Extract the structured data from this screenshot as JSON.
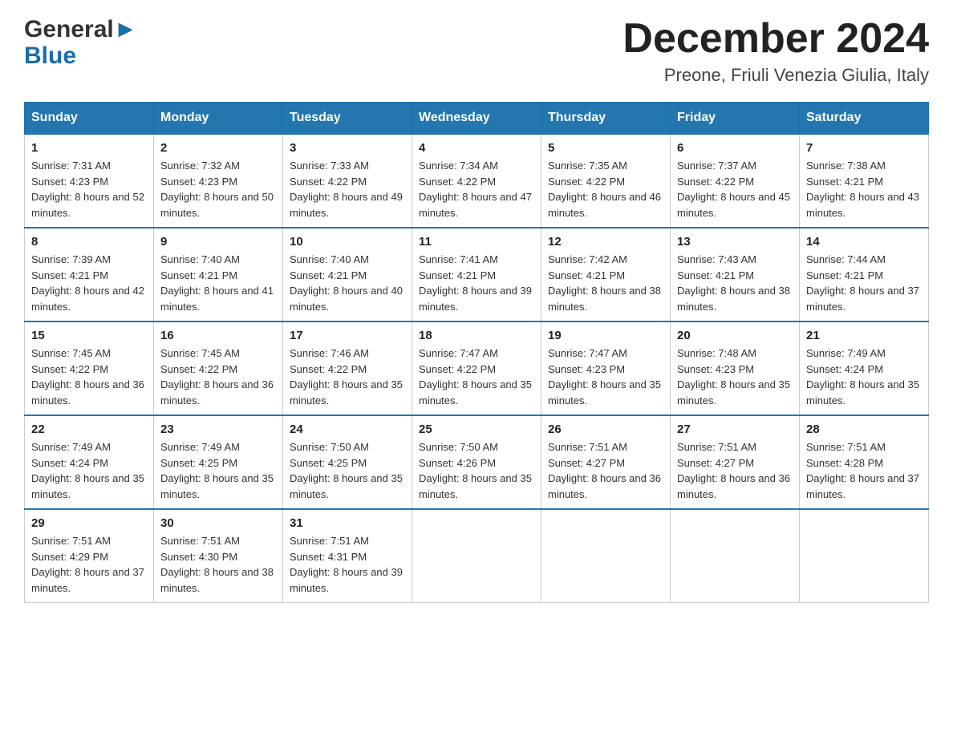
{
  "header": {
    "logo_line1_black": "General",
    "logo_line1_blue": "▶",
    "logo_line2": "Blue",
    "main_title": "December 2024",
    "subtitle": "Preone, Friuli Venezia Giulia, Italy"
  },
  "calendar": {
    "days_of_week": [
      "Sunday",
      "Monday",
      "Tuesday",
      "Wednesday",
      "Thursday",
      "Friday",
      "Saturday"
    ],
    "weeks": [
      [
        {
          "day": "1",
          "sunrise": "7:31 AM",
          "sunset": "4:23 PM",
          "daylight": "8 hours and 52 minutes."
        },
        {
          "day": "2",
          "sunrise": "7:32 AM",
          "sunset": "4:23 PM",
          "daylight": "8 hours and 50 minutes."
        },
        {
          "day": "3",
          "sunrise": "7:33 AM",
          "sunset": "4:22 PM",
          "daylight": "8 hours and 49 minutes."
        },
        {
          "day": "4",
          "sunrise": "7:34 AM",
          "sunset": "4:22 PM",
          "daylight": "8 hours and 47 minutes."
        },
        {
          "day": "5",
          "sunrise": "7:35 AM",
          "sunset": "4:22 PM",
          "daylight": "8 hours and 46 minutes."
        },
        {
          "day": "6",
          "sunrise": "7:37 AM",
          "sunset": "4:22 PM",
          "daylight": "8 hours and 45 minutes."
        },
        {
          "day": "7",
          "sunrise": "7:38 AM",
          "sunset": "4:21 PM",
          "daylight": "8 hours and 43 minutes."
        }
      ],
      [
        {
          "day": "8",
          "sunrise": "7:39 AM",
          "sunset": "4:21 PM",
          "daylight": "8 hours and 42 minutes."
        },
        {
          "day": "9",
          "sunrise": "7:40 AM",
          "sunset": "4:21 PM",
          "daylight": "8 hours and 41 minutes."
        },
        {
          "day": "10",
          "sunrise": "7:40 AM",
          "sunset": "4:21 PM",
          "daylight": "8 hours and 40 minutes."
        },
        {
          "day": "11",
          "sunrise": "7:41 AM",
          "sunset": "4:21 PM",
          "daylight": "8 hours and 39 minutes."
        },
        {
          "day": "12",
          "sunrise": "7:42 AM",
          "sunset": "4:21 PM",
          "daylight": "8 hours and 38 minutes."
        },
        {
          "day": "13",
          "sunrise": "7:43 AM",
          "sunset": "4:21 PM",
          "daylight": "8 hours and 38 minutes."
        },
        {
          "day": "14",
          "sunrise": "7:44 AM",
          "sunset": "4:21 PM",
          "daylight": "8 hours and 37 minutes."
        }
      ],
      [
        {
          "day": "15",
          "sunrise": "7:45 AM",
          "sunset": "4:22 PM",
          "daylight": "8 hours and 36 minutes."
        },
        {
          "day": "16",
          "sunrise": "7:45 AM",
          "sunset": "4:22 PM",
          "daylight": "8 hours and 36 minutes."
        },
        {
          "day": "17",
          "sunrise": "7:46 AM",
          "sunset": "4:22 PM",
          "daylight": "8 hours and 35 minutes."
        },
        {
          "day": "18",
          "sunrise": "7:47 AM",
          "sunset": "4:22 PM",
          "daylight": "8 hours and 35 minutes."
        },
        {
          "day": "19",
          "sunrise": "7:47 AM",
          "sunset": "4:23 PM",
          "daylight": "8 hours and 35 minutes."
        },
        {
          "day": "20",
          "sunrise": "7:48 AM",
          "sunset": "4:23 PM",
          "daylight": "8 hours and 35 minutes."
        },
        {
          "day": "21",
          "sunrise": "7:49 AM",
          "sunset": "4:24 PM",
          "daylight": "8 hours and 35 minutes."
        }
      ],
      [
        {
          "day": "22",
          "sunrise": "7:49 AM",
          "sunset": "4:24 PM",
          "daylight": "8 hours and 35 minutes."
        },
        {
          "day": "23",
          "sunrise": "7:49 AM",
          "sunset": "4:25 PM",
          "daylight": "8 hours and 35 minutes."
        },
        {
          "day": "24",
          "sunrise": "7:50 AM",
          "sunset": "4:25 PM",
          "daylight": "8 hours and 35 minutes."
        },
        {
          "day": "25",
          "sunrise": "7:50 AM",
          "sunset": "4:26 PM",
          "daylight": "8 hours and 35 minutes."
        },
        {
          "day": "26",
          "sunrise": "7:51 AM",
          "sunset": "4:27 PM",
          "daylight": "8 hours and 36 minutes."
        },
        {
          "day": "27",
          "sunrise": "7:51 AM",
          "sunset": "4:27 PM",
          "daylight": "8 hours and 36 minutes."
        },
        {
          "day": "28",
          "sunrise": "7:51 AM",
          "sunset": "4:28 PM",
          "daylight": "8 hours and 37 minutes."
        }
      ],
      [
        {
          "day": "29",
          "sunrise": "7:51 AM",
          "sunset": "4:29 PM",
          "daylight": "8 hours and 37 minutes."
        },
        {
          "day": "30",
          "sunrise": "7:51 AM",
          "sunset": "4:30 PM",
          "daylight": "8 hours and 38 minutes."
        },
        {
          "day": "31",
          "sunrise": "7:51 AM",
          "sunset": "4:31 PM",
          "daylight": "8 hours and 39 minutes."
        },
        null,
        null,
        null,
        null
      ]
    ]
  }
}
